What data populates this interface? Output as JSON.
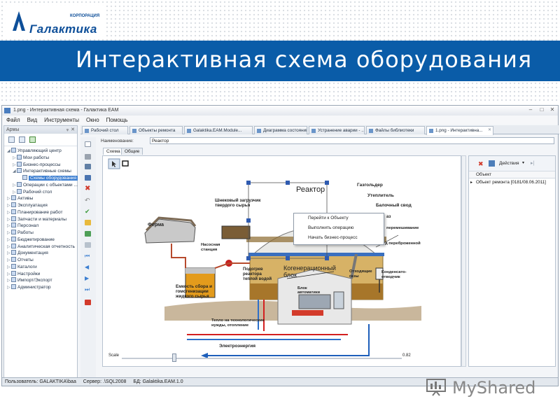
{
  "slide": {
    "logo_text": "Галактика",
    "logo_corp": "КОРПОРАЦИЯ",
    "title": "Интерактивная схема оборудования",
    "watermark": "MyShared"
  },
  "window": {
    "title": "1.png - Интерактивная схема - Галактика EAM",
    "menu": [
      "Файл",
      "Вид",
      "Инструменты",
      "Окно",
      "Помощь"
    ]
  },
  "left_panel": {
    "header": "Армы",
    "tree": [
      {
        "label": "Управляющий центр",
        "level": 0,
        "expanded": true
      },
      {
        "label": "Мои работы",
        "level": 1
      },
      {
        "label": "Бизнес-процессы",
        "level": 1
      },
      {
        "label": "Интерактивные схемы",
        "level": 1,
        "expanded": true
      },
      {
        "label": "Схемы оборудования",
        "level": 2,
        "selected": true
      },
      {
        "label": "Операции с объектами ...",
        "level": 1
      },
      {
        "label": "Рабочий стол",
        "level": 1
      },
      {
        "label": "Активы",
        "level": 0
      },
      {
        "label": "Эксплуатация",
        "level": 0
      },
      {
        "label": "Планирование работ",
        "level": 0
      },
      {
        "label": "Запчасти и материалы",
        "level": 0
      },
      {
        "label": "Персонал",
        "level": 0
      },
      {
        "label": "Работы",
        "level": 0
      },
      {
        "label": "Бюджетирование",
        "level": 0
      },
      {
        "label": "Аналитическая отчетность",
        "level": 0
      },
      {
        "label": "Документация",
        "level": 0
      },
      {
        "label": "Отчеты",
        "level": 0
      },
      {
        "label": "Каталоги",
        "level": 0
      },
      {
        "label": "Настройки",
        "level": 0
      },
      {
        "label": "Импорт/Экспорт",
        "level": 0
      },
      {
        "label": "Администратор",
        "level": 0
      }
    ]
  },
  "tabs": [
    {
      "label": "Рабочий стол"
    },
    {
      "label": "Объекты ремонта"
    },
    {
      "label": "Galaktika.EAM.Module..."
    },
    {
      "label": "Диаграмма состояний"
    },
    {
      "label": "Устранение аварии - ..."
    },
    {
      "label": "Файлы библиотеки"
    },
    {
      "label": "1.png - Интерактивна...",
      "active": true
    }
  ],
  "form": {
    "name_label": "Наименование:",
    "name_value": "Реактор",
    "inner_tabs": [
      "Схема",
      "Общие"
    ]
  },
  "diagram": {
    "labels": {
      "reactor": "Реактор",
      "gas_holder": "Газгольдер",
      "insulation": "Утеплитель",
      "beam_vault": "Балочный свод",
      "screw_loader": "Шнековый загрузчик твердого сырья",
      "farm": "Ферма",
      "pump_station": "Насосная станция",
      "storage_tank": "Емкость сбора и гомогенизации жидкого сырья",
      "reactor_heating": "Подогрев реактора теплой водой",
      "cogeneration": "Когенерационный блок",
      "exhaust_gas": "Отходящие газы",
      "condensate_drain": "Конденсато-отводчик",
      "automation_block": "Блок автоматики",
      "heat_supply": "Тепло на технологические нужды, отопление",
      "electricity": "Электроэнергия",
      "mixing": "перемешивание",
      "fermented": "д переброженной",
      "gas_partial": "аз"
    }
  },
  "context_menu": [
    "Перейти к Объекту",
    "Выполнить операцию",
    "Начать бизнес-процесс"
  ],
  "scale": {
    "label": "Scale",
    "value": "0.82",
    "fraction": 0.18
  },
  "right_panel": {
    "actions_label": "Действия",
    "column": "Объект",
    "rows": [
      "Объект ремонта [0181/08.06.2011]"
    ]
  },
  "status": {
    "user": "Пользователь: GALAKTIKA\\baa",
    "server": "Сервер: .\\SQL2008",
    "db": "БД: Galaktika.EAM.1.0"
  },
  "colors": {
    "banner": "#0a5ca8",
    "accent": "#3d7fd1"
  }
}
